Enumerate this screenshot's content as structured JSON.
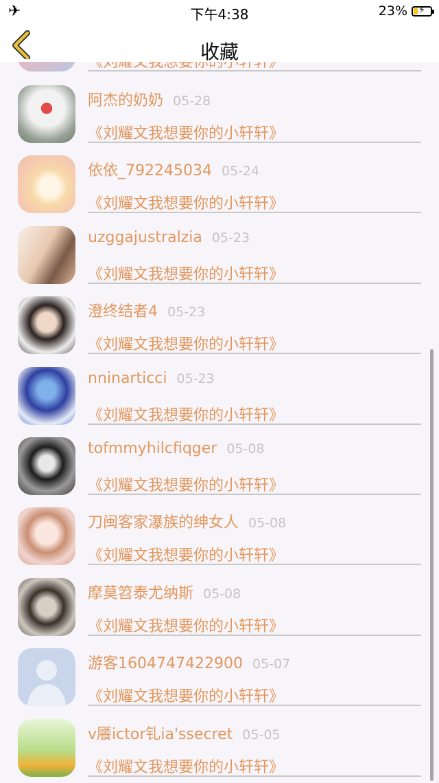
{
  "status_bar": {
    "time": "下午4:38",
    "battery_percent": "23%",
    "battery_level": 0.23,
    "airplane_icon": "airplane-icon",
    "charging_icon": "bolt-icon"
  },
  "nav": {
    "title": "收藏",
    "back_icon": "chevron-left-icon",
    "back_color": "#e6c23a"
  },
  "colors": {
    "name": "#e2975d",
    "date": "#c4c4c4",
    "divider": "#c9c9c9",
    "background": "#f7f5f9"
  },
  "favorites": [
    {
      "name": "",
      "date": "",
      "message": "《刘耀文我想要你的小轩轩》"
    },
    {
      "name": "阿杰的奶奶",
      "date": "05-28",
      "message": "《刘耀文我想要你的小轩轩》"
    },
    {
      "name": "依依_792245034",
      "date": "05-24",
      "message": "《刘耀文我想要你的小轩轩》"
    },
    {
      "name": "uzggajustralzia",
      "date": "05-23",
      "message": "《刘耀文我想要你的小轩轩》"
    },
    {
      "name": "澄终结者4",
      "date": "05-23",
      "message": "《刘耀文我想要你的小轩轩》"
    },
    {
      "name": "nninarticci",
      "date": "05-23",
      "message": "《刘耀文我想要你的小轩轩》"
    },
    {
      "name": "tofmmyhilcfiqger",
      "date": "05-08",
      "message": "《刘耀文我想要你的小轩轩》"
    },
    {
      "name": "刀闽客家瀑族的绅女人",
      "date": "05-08",
      "message": "《刘耀文我想要你的小轩轩》"
    },
    {
      "name": "摩莫笤泰尤纳斯",
      "date": "05-08",
      "message": "《刘耀文我想要你的小轩轩》"
    },
    {
      "name": "游客1604747422900",
      "date": "05-07",
      "message": "《刘耀文我想要你的小轩轩》"
    },
    {
      "name": "v餍ictor钆ia'ssecret",
      "date": "05-05",
      "message": "《刘耀文我想要你的小轩轩》"
    }
  ]
}
